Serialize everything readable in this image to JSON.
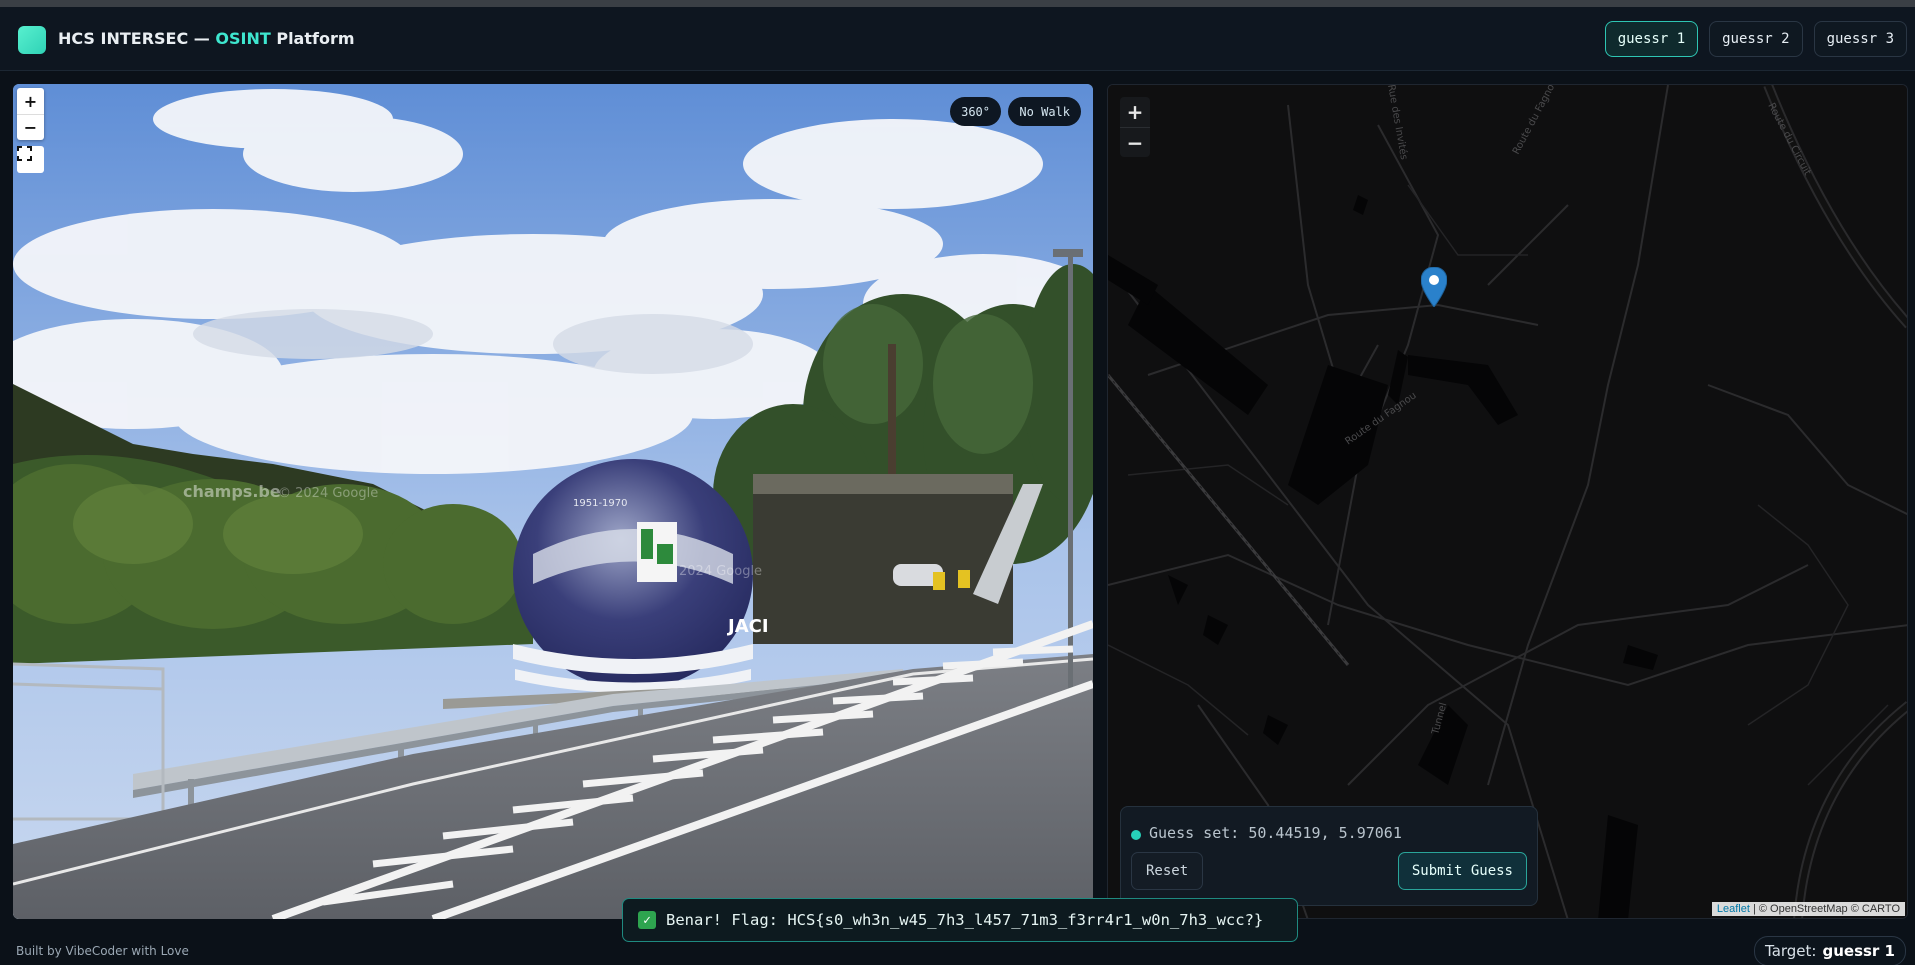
{
  "header": {
    "title_prefix": "HCS INTERSEC — ",
    "title_accent": "OSINT",
    "title_suffix": " Platform",
    "accent_color": "#3ee6cf",
    "tabs": [
      {
        "label": "guessr 1",
        "active": true
      },
      {
        "label": "guessr 2",
        "active": false
      },
      {
        "label": "guessr 3",
        "active": false
      }
    ]
  },
  "street_view": {
    "zoom_in": "+",
    "zoom_out": "−",
    "fullscreen_icon": "fullscreen-icon",
    "btn_360": "360°",
    "btn_no_walk": "No Walk",
    "sign_text": "1951-1970",
    "sign_text_2": "JACI",
    "watermark": "© 2024 Google",
    "watermark_2": "2024 Google",
    "partial_site_text": "champs.be"
  },
  "map": {
    "zoom_in": "+",
    "zoom_out": "−",
    "marker_icon": "map-pin-icon",
    "road_labels": [
      "Route du Fagnou",
      "Route du Fagnou",
      "Route du Circuit",
      "Tunnel",
      "Rue des Invités"
    ],
    "attribution_leaflet": "Leaflet",
    "attribution_rest": " | © OpenStreetMap © CARTO"
  },
  "guess": {
    "status": "Guess set: 50.44519, 5.97061",
    "reset": "Reset",
    "submit": "Submit Guess"
  },
  "toast": {
    "icon": "check-icon",
    "message": "Benar! Flag: HCS{s0_wh3n_w45_7h3_l457_71m3_f3rr4r1_w0n_7h3_wcc?}"
  },
  "footer": {
    "built_by": "Built by VibeCoder with Love",
    "target_label": "Target: ",
    "target_value": "guessr 1"
  }
}
